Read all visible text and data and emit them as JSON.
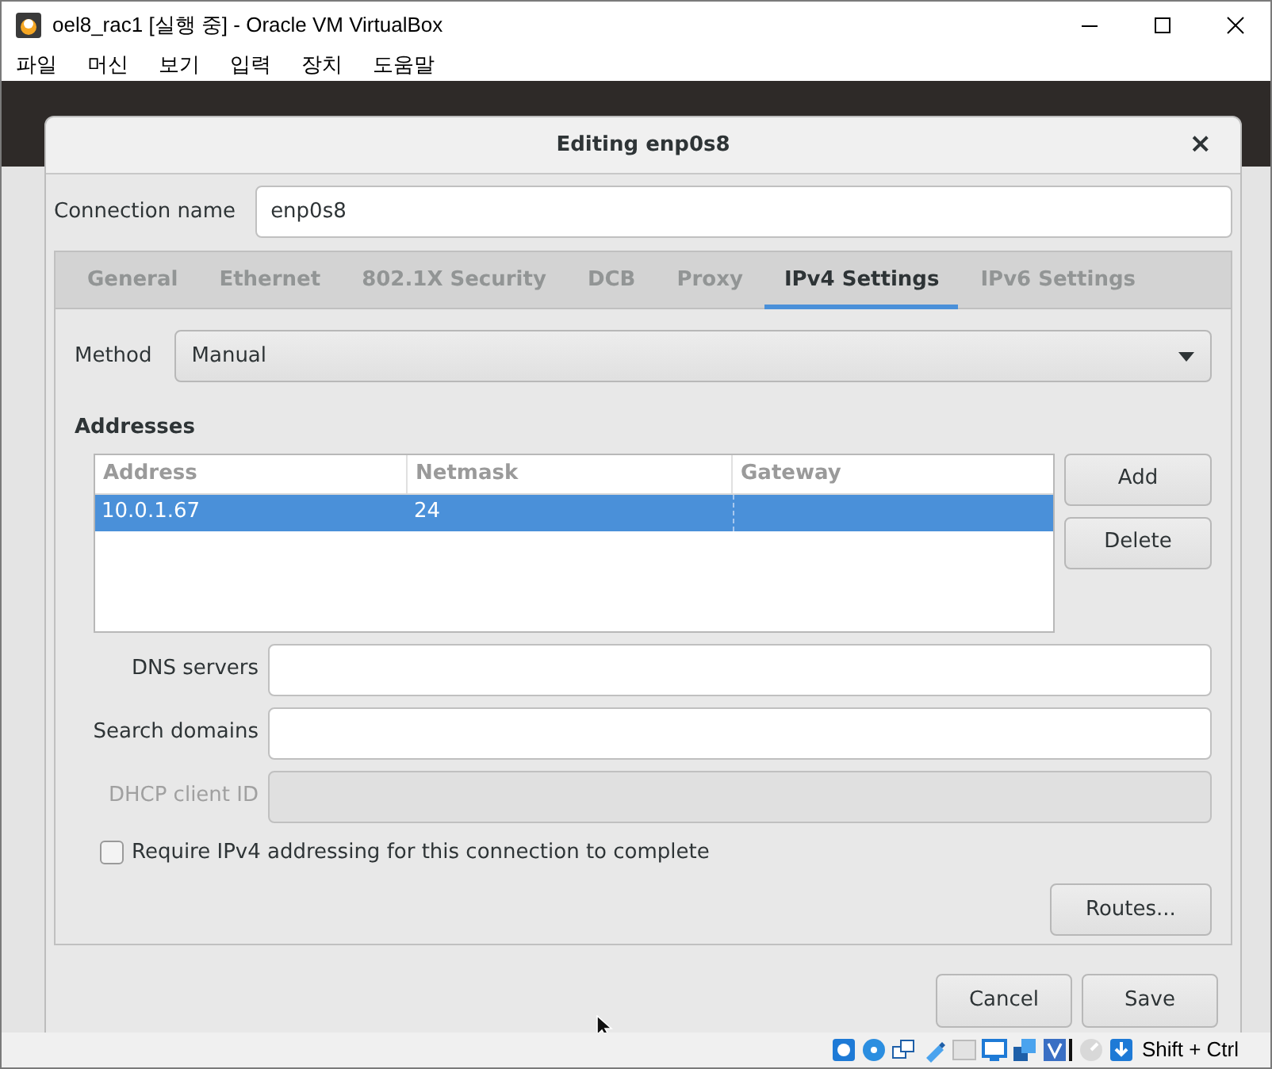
{
  "window": {
    "title": "oel8_rac1 [실행 중] - Oracle VM VirtualBox"
  },
  "menu": [
    "파일",
    "머신",
    "보기",
    "입력",
    "장치",
    "도움말"
  ],
  "dialog": {
    "title": "Editing enp0s8",
    "close": "×",
    "connection_name": {
      "label": "Connection name",
      "value": "enp0s8"
    },
    "tabs": [
      {
        "label": "General",
        "selected": false
      },
      {
        "label": "Ethernet",
        "selected": false
      },
      {
        "label": "802.1X Security",
        "selected": false
      },
      {
        "label": "DCB",
        "selected": false
      },
      {
        "label": "Proxy",
        "selected": false
      },
      {
        "label": "IPv4 Settings",
        "selected": true
      },
      {
        "label": "IPv6 Settings",
        "selected": false
      }
    ],
    "method": {
      "label": "Method",
      "value": "Manual"
    },
    "addresses": {
      "heading": "Addresses",
      "columns": [
        "Address",
        "Netmask",
        "Gateway"
      ],
      "rows": [
        {
          "address": "10.0.1.67",
          "netmask": "24",
          "selected": true
        }
      ],
      "buttons": [
        "Add",
        "Delete"
      ]
    },
    "fields": [
      {
        "label": "DNS servers",
        "disabled": false
      },
      {
        "label": "Search domains",
        "disabled": false
      },
      {
        "label": "DHCP client ID",
        "disabled": true
      }
    ],
    "require_option": {
      "label": "Require IPv4 addressing for this connection to complete",
      "checked": false
    },
    "routes_button": "Routes...",
    "footer_buttons": [
      "Cancel",
      "Save"
    ]
  },
  "status_bar": {
    "host_key": "Shift + Ctrl"
  }
}
